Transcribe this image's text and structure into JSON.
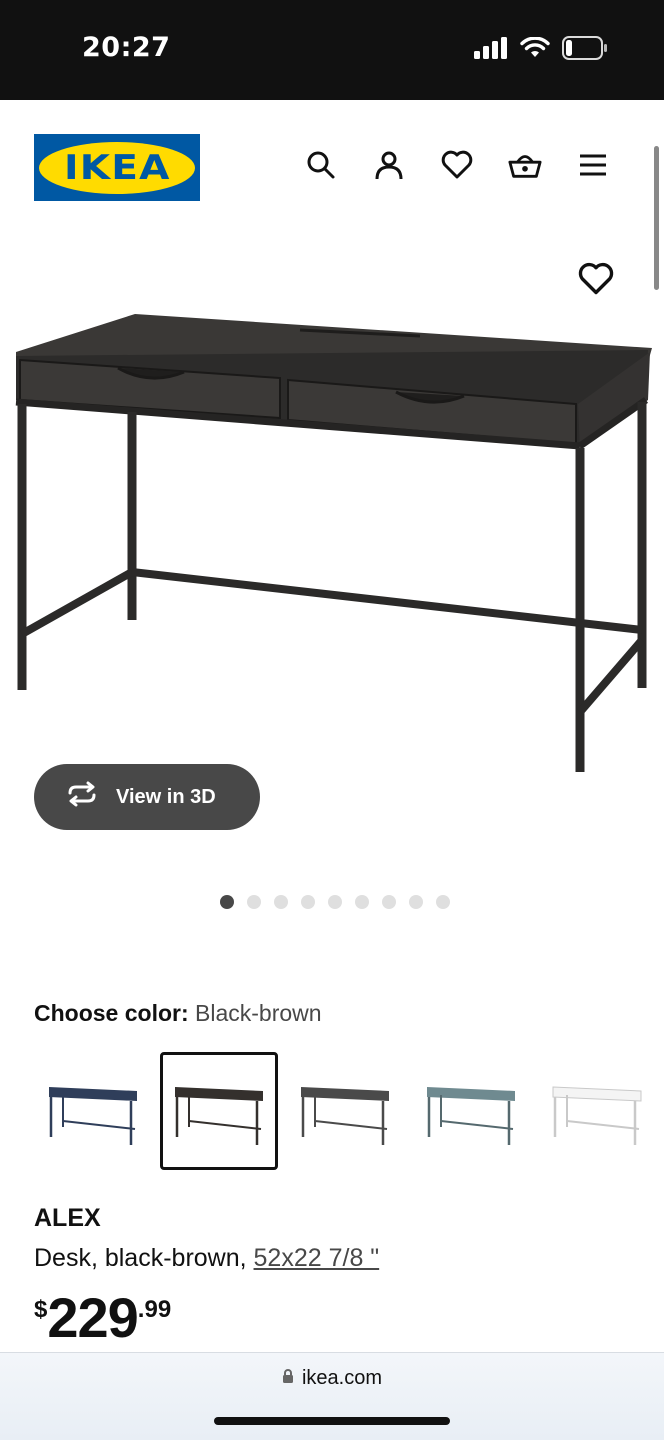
{
  "status_bar": {
    "time": "20:27"
  },
  "header": {
    "logo_text": "IKEA",
    "icons": [
      "search-icon",
      "account-icon",
      "heart-icon",
      "basket-icon",
      "menu-icon"
    ]
  },
  "gallery": {
    "view_3d_label": "View in 3D",
    "dots_count": 9,
    "active_dot": 1
  },
  "color": {
    "label": "Choose color:",
    "selected": "Black-brown",
    "swatches": [
      "blue",
      "black-brown",
      "gray",
      "gray-turquoise",
      "white"
    ],
    "selected_index": 1
  },
  "product": {
    "name": "ALEX",
    "description": "Desk, black-brown,",
    "size": "52x22 7/8 \"",
    "price_currency": "$",
    "price_integer": "229",
    "price_decimal": ".99"
  },
  "browser": {
    "url": "ikea.com"
  },
  "colors": {
    "ikea_blue": "#0058a3",
    "ikea_yellow": "#ffdb00",
    "button_gray": "#484848"
  }
}
